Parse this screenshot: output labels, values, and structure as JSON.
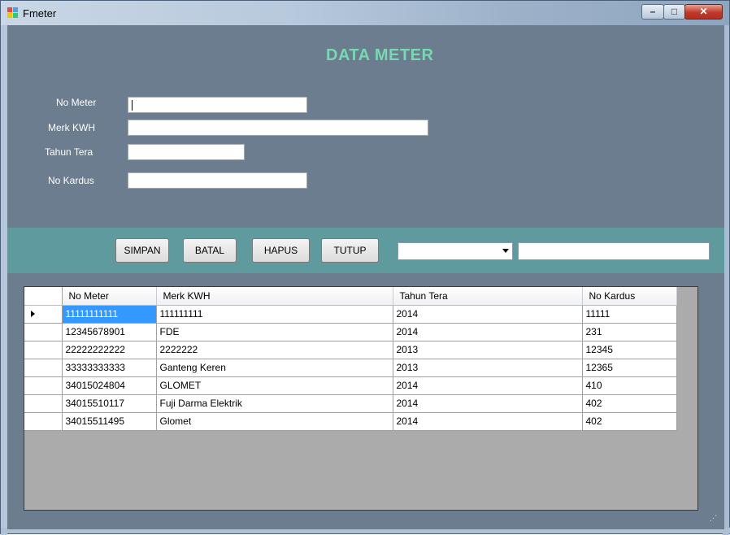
{
  "window": {
    "title": "Fmeter",
    "controls": {
      "minimize": "–",
      "maximize": "□",
      "close": "✕"
    }
  },
  "form": {
    "heading": "DATA METER",
    "fields": [
      {
        "label": "No Meter",
        "value": ""
      },
      {
        "label": "Merk KWH",
        "value": ""
      },
      {
        "label": "Tahun Tera",
        "value": ""
      },
      {
        "label": "No Kardus",
        "value": ""
      }
    ]
  },
  "toolbar": {
    "buttons": [
      "SIMPAN",
      "BATAL",
      "HAPUS",
      "TUTUP"
    ],
    "combo_value": "",
    "search_value": ""
  },
  "grid": {
    "columns": [
      "No Meter",
      "Merk KWH",
      "Tahun Tera",
      "No Kardus"
    ],
    "rows": [
      [
        "11111111111",
        "111111111",
        "2014",
        "11111"
      ],
      [
        "12345678901",
        "FDE",
        "2014",
        "231"
      ],
      [
        "22222222222",
        "2222222",
        "2013",
        "12345"
      ],
      [
        "33333333333",
        "Ganteng Keren",
        "2013",
        "12365"
      ],
      [
        "34015024804",
        "GLOMET",
        "2014",
        "410"
      ],
      [
        "34015510117",
        "Fuji Darma Elektrik",
        "2014",
        "402"
      ],
      [
        "34015511495",
        "Glomet",
        "2014",
        "402"
      ]
    ],
    "current_row": 0
  },
  "colors": {
    "client_bg": "#6c7d8f",
    "heading": "#79d8b1",
    "toolbar_bg": "#5f9a9e",
    "selection": "#3399ff"
  }
}
